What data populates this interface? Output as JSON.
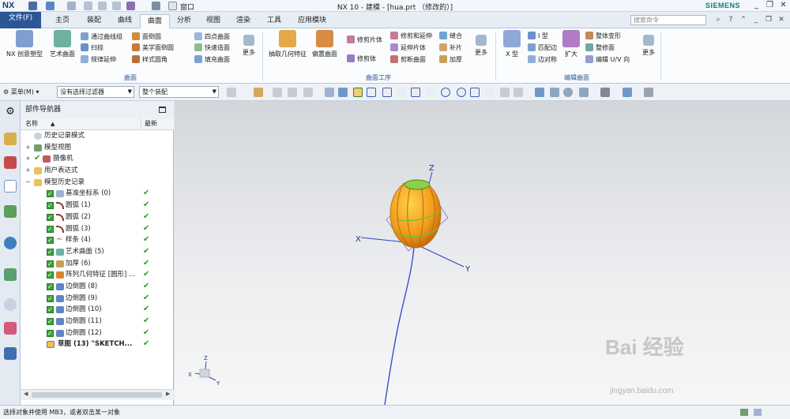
{
  "title_bar": {
    "logo": "NX",
    "title": "NX 10 - 建模 - [hua.prt （修改的）]",
    "window_menu": "窗口",
    "brand": "SIEMENS",
    "minimize": "_",
    "restore": "❐",
    "close": "✕"
  },
  "menu": {
    "file": "文件(F)",
    "tabs": [
      "主页",
      "装配",
      "曲线",
      "曲面",
      "分析",
      "视图",
      "渲染",
      "工具",
      "应用模块"
    ],
    "active_tab": "曲面",
    "search_placeholder": "搜索命令"
  },
  "ribbon": {
    "surface_group": {
      "label": "曲面",
      "big": [
        "NX 创意塑型",
        "艺术曲面"
      ],
      "small": [
        "通过曲线组",
        "扫掠",
        "规律延伸",
        "面倒圆",
        "美学面倒圆",
        "样式圆角",
        "四点曲面",
        "快速造面",
        "填充曲面"
      ],
      "more": "更多"
    },
    "ops_group": {
      "label": "曲面工序",
      "big": [
        "抽取几何特征",
        "偏置曲面"
      ],
      "small": [
        "修剪片体",
        "修剪体",
        "修剪和延伸",
        "延伸片体",
        "剪断曲面",
        "缝合",
        "补片",
        "加厚"
      ],
      "more": "更多"
    },
    "edit_group": {
      "label": "编辑曲面",
      "big": [
        "X 型",
        "扩大"
      ],
      "small": [
        "I 型",
        "匹配边",
        "边对称",
        "整体变形",
        "整修面",
        "编辑 U/V 向"
      ],
      "more": "更多"
    }
  },
  "toolbar": {
    "menu_label": "菜单(M)",
    "filter": "没有选择过滤器",
    "scope": "整个装配"
  },
  "navigator": {
    "title": "部件导航器",
    "col_name": "名称",
    "col_latest": "最新",
    "top_items": [
      {
        "label": "历史记录模式"
      },
      {
        "label": "模型视图"
      },
      {
        "label": "摄像机"
      },
      {
        "label": "用户表达式"
      },
      {
        "label": "模型历史记录"
      }
    ],
    "history": [
      {
        "label": "基准坐标系 (0)"
      },
      {
        "label": "圆弧 (1)"
      },
      {
        "label": "圆弧 (2)"
      },
      {
        "label": "圆弧 (3)"
      },
      {
        "label": "样条 (4)"
      },
      {
        "label": "艺术曲面 (5)"
      },
      {
        "label": "加厚 (6)"
      },
      {
        "label": "阵列几何特征 [圆形] ..."
      },
      {
        "label": "边倒圆 (8)"
      },
      {
        "label": "边倒圆 (9)"
      },
      {
        "label": "边倒圆 (10)"
      },
      {
        "label": "边倒圆 (11)"
      },
      {
        "label": "边倒圆 (12)"
      },
      {
        "label": "草图 (13) \"SKETCH..."
      }
    ]
  },
  "viewport": {
    "axes": {
      "x": "X",
      "y": "Y",
      "z": "Z"
    },
    "watermark": "Bai 经验",
    "watermark_url": "jingyan.baidu.com"
  },
  "status": "选择对象并使用 MB3，或者双击某一对象",
  "colors": {
    "file_blue": "#2b5797",
    "check_green": "#2e9b2e",
    "model_orange": "#f2a21c",
    "curve_blue": "#2c43c8"
  }
}
